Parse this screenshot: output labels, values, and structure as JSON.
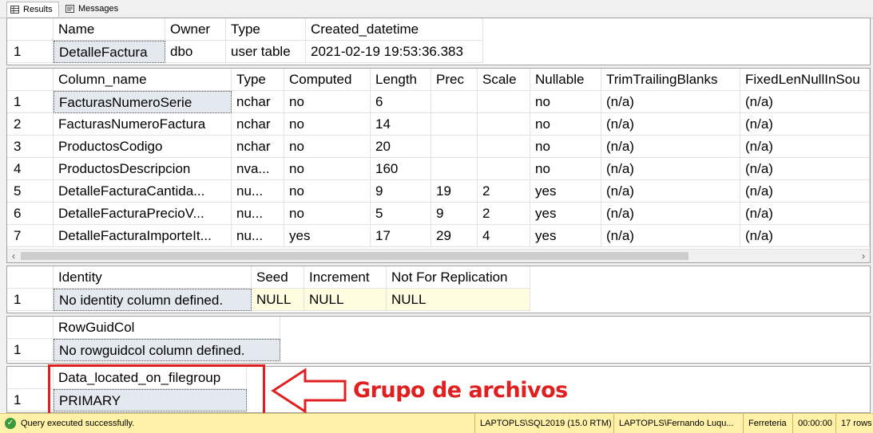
{
  "tabs": [
    {
      "label": "Results",
      "icon": "grid-icon",
      "active": true
    },
    {
      "label": "Messages",
      "icon": "messages-icon",
      "active": false
    }
  ],
  "grid1": {
    "headers": [
      "Name",
      "Owner",
      "Type",
      "Created_datetime"
    ],
    "rows": [
      [
        "1",
        "DetalleFactura",
        "dbo",
        "user table",
        "2021-02-19 19:53:36.383"
      ]
    ]
  },
  "grid2": {
    "headers": [
      "Column_name",
      "Type",
      "Computed",
      "Length",
      "Prec",
      "Scale",
      "Nullable",
      "TrimTrailingBlanks",
      "FixedLenNullInSou"
    ],
    "rows": [
      [
        "1",
        "FacturasNumeroSerie",
        "nchar",
        "no",
        "6",
        "",
        "",
        "no",
        "(n/a)",
        "(n/a)"
      ],
      [
        "2",
        "FacturasNumeroFactura",
        "nchar",
        "no",
        "14",
        "",
        "",
        "no",
        "(n/a)",
        "(n/a)"
      ],
      [
        "3",
        "ProductosCodigo",
        "nchar",
        "no",
        "20",
        "",
        "",
        "no",
        "(n/a)",
        "(n/a)"
      ],
      [
        "4",
        "ProductosDescripcion",
        "nva...",
        "no",
        "160",
        "",
        "",
        "no",
        "(n/a)",
        "(n/a)"
      ],
      [
        "5",
        "DetalleFacturaCantida...",
        "nu...",
        "no",
        "9",
        "19",
        "2",
        "yes",
        "(n/a)",
        "(n/a)"
      ],
      [
        "6",
        "DetalleFacturaPrecioV...",
        "nu...",
        "no",
        "5",
        "9",
        "2",
        "yes",
        "(n/a)",
        "(n/a)"
      ],
      [
        "7",
        "DetalleFacturaImporteIt...",
        "nu...",
        "yes",
        "17",
        "29",
        "4",
        "yes",
        "(n/a)",
        "(n/a)"
      ]
    ]
  },
  "grid3": {
    "headers": [
      "Identity",
      "Seed",
      "Increment",
      "Not For Replication"
    ],
    "rows": [
      [
        "1",
        "No identity column defined.",
        "NULL",
        "NULL",
        "NULL"
      ]
    ]
  },
  "grid4": {
    "headers": [
      "RowGuidCol"
    ],
    "rows": [
      [
        "1",
        "No rowguidcol column defined."
      ]
    ]
  },
  "grid5": {
    "headers": [
      "Data_located_on_filegroup"
    ],
    "rows": [
      [
        "1",
        "PRIMARY"
      ]
    ]
  },
  "annotation": {
    "text": "Grupo de archivos",
    "color": "#e02020"
  },
  "status": {
    "message": "Query executed successfully.",
    "server": "LAPTOPLS\\SQL2019 (15.0 RTM)",
    "user": "LAPTOPLS\\Fernando Luqu...",
    "database": "Ferreteria",
    "time": "00:00:00",
    "rows": "17 rows",
    "bg_color": "#fff2a8"
  }
}
